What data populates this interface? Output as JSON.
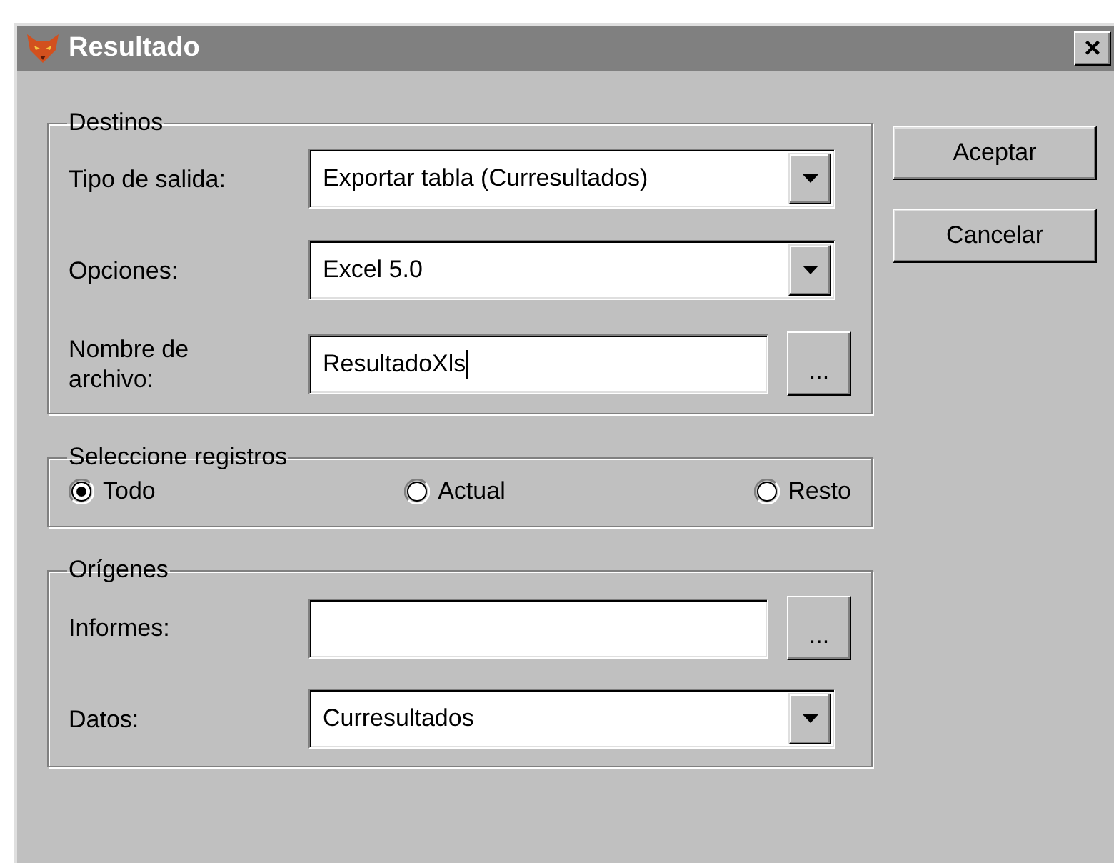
{
  "window": {
    "title": "Resultado",
    "close": "×"
  },
  "destinos": {
    "title": "Destinos",
    "rows": [
      {
        "kind": "combo",
        "label": "Tipo de salida:",
        "value": "Exportar tabla (Curresultados)"
      },
      {
        "kind": "combo",
        "label": "Opciones:",
        "value": "Excel 5.0"
      },
      {
        "kind": "text",
        "label": "Nombre de archivo:",
        "value": "ResultadoXls",
        "button": "...",
        "focused": true
      }
    ]
  },
  "registros": {
    "title": "Seleccione registros",
    "options": [
      {
        "label": "Todo",
        "selected": true
      },
      {
        "label": "Actual",
        "selected": false
      },
      {
        "label": "Resto",
        "selected": false
      }
    ]
  },
  "origenes": {
    "title": "Orígenes",
    "rows": [
      {
        "kind": "text",
        "label": "Informes:",
        "button": "...",
        "focused": false
      },
      {
        "kind": "combo",
        "label": "Datos:",
        "value": "Curresultados"
      }
    ]
  },
  "buttons": [
    "Aceptar",
    "Cancelar"
  ]
}
